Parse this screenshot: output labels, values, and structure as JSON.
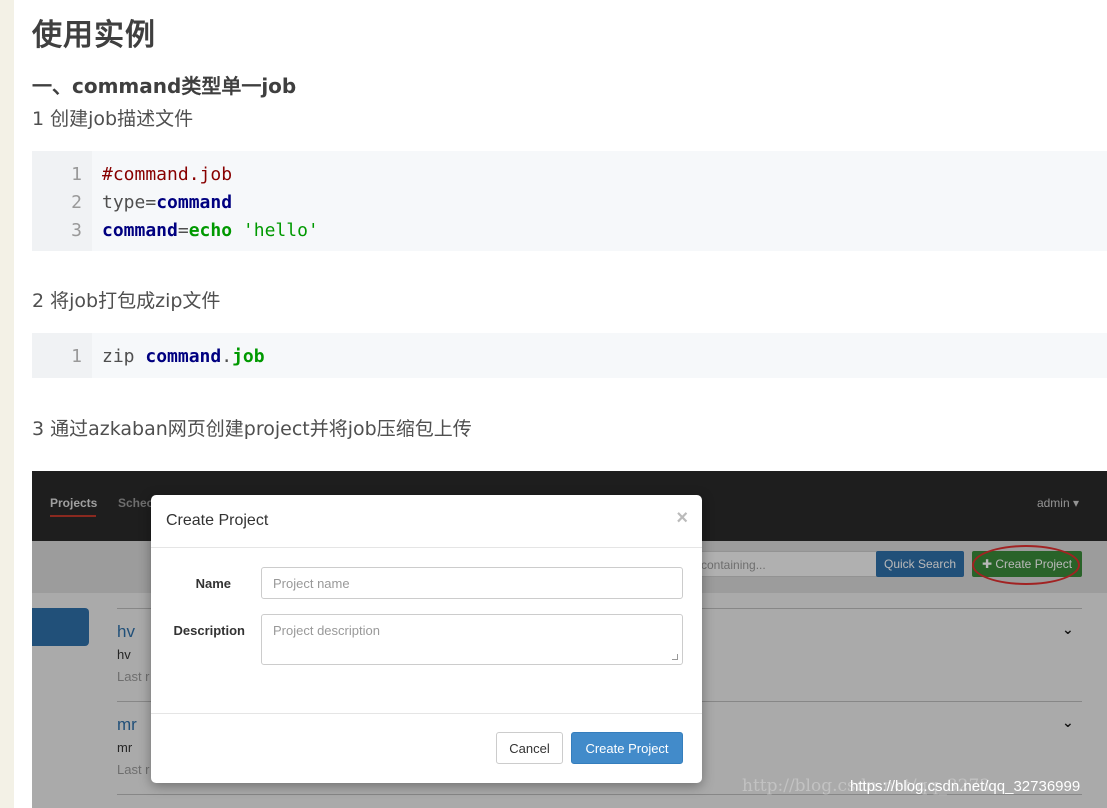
{
  "title": "使用实例",
  "section": "一、command类型单一job",
  "step1": "1 创建job描述文件",
  "code1": {
    "line_numbers": [
      "1",
      "2",
      "3"
    ],
    "line1": "#command.job",
    "line2_key": "type",
    "line2_eq": "=",
    "line2_val": "command",
    "line3_key": "command",
    "line3_eq": "=",
    "line3_cmd": "echo",
    "line3_str": "'hello'"
  },
  "step2": "2 将job打包成zip文件",
  "code2": {
    "line_numbers": [
      "1"
    ],
    "cmd": "zip",
    "arg": "command",
    "dot": ".",
    "ext": "job"
  },
  "step3": "3 通过azkaban网页创建project并将job压缩包上传",
  "azkaban": {
    "nav": {
      "projects": "Projects",
      "scheduling": "Schec",
      "user": "admin ▾"
    },
    "search_placeholder": "containing...",
    "quick_search": "Quick Search",
    "create_project": "✚ Create Project",
    "projects": [
      {
        "name": "hv",
        "desc": "hv",
        "last": "Last r"
      },
      {
        "name": "mr",
        "desc": "mr",
        "last": "Last r"
      }
    ],
    "modal": {
      "title": "Create Project",
      "close": "×",
      "name_label": "Name",
      "name_placeholder": "Project name",
      "desc_label": "Description",
      "desc_placeholder": "Project description",
      "cancel": "Cancel",
      "submit": "Create Project"
    },
    "watermark": "http://blog.csdn.net/qq_3273",
    "watermark_url": "https://blog.csdn.net/qq_32736999"
  },
  "colors": {
    "accent_blue": "#428bca",
    "create_green": "#3a8a3a",
    "highlight_red": "#e03030",
    "code_comment": "#880000",
    "code_keyword": "#000080",
    "code_string": "#009900"
  }
}
